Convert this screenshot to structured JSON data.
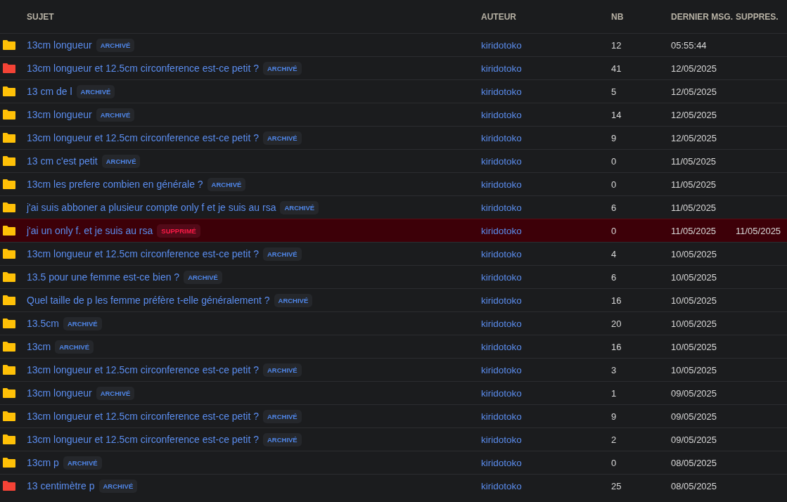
{
  "table": {
    "columns": [
      "SUJET",
      "AUTEUR",
      "NB",
      "DERNIER MSG.",
      "SUPPRES."
    ],
    "rows": [
      {
        "color": "#ffc107",
        "subject": "13cm longueur",
        "badge": {
          "label": "ARCHIVÉ",
          "kind": "archived"
        },
        "author": "kiridotoko",
        "count": "12",
        "last": "05:55:44"
      },
      {
        "color": "#f44336",
        "subject": "13cm longueur et 12.5cm circonference est-ce petit ?",
        "badge": {
          "label": "ARCHIVÉ",
          "kind": "archived"
        },
        "author": "kiridotoko",
        "count": "41",
        "last": "12/05/2025"
      },
      {
        "color": "#ffc107",
        "subject": "13 cm de l",
        "badge": {
          "label": "ARCHIVÉ",
          "kind": "archived"
        },
        "author": "kiridotoko",
        "count": "5",
        "last": "12/05/2025"
      },
      {
        "color": "#ffc107",
        "subject": "13cm longueur",
        "badge": {
          "label": "ARCHIVÉ",
          "kind": "archived"
        },
        "author": "kiridotoko",
        "count": "14",
        "last": "12/05/2025"
      },
      {
        "color": "#ffc107",
        "subject": "13cm longueur et 12.5cm circonference est-ce petit ?",
        "badge": {
          "label": "ARCHIVÉ",
          "kind": "archived"
        },
        "author": "kiridotoko",
        "count": "9",
        "last": "12/05/2025"
      },
      {
        "color": "#ffc107",
        "subject": "13 cm c'est petit",
        "badge": {
          "label": "ARCHIVÉ",
          "kind": "archived"
        },
        "author": "kiridotoko",
        "count": "0",
        "last": "11/05/2025"
      },
      {
        "color": "#ffc107",
        "subject": "13cm les prefere combien en générale ?",
        "badge": {
          "label": "ARCHIVÉ",
          "kind": "archived"
        },
        "author": "kiridotoko",
        "count": "0",
        "last": "11/05/2025"
      },
      {
        "color": "#ffc107",
        "subject": "j'ai suis abboner a plusieur compte only f et je suis au rsa",
        "badge": {
          "label": "ARCHIVÉ",
          "kind": "archived"
        },
        "author": "kiridotoko",
        "count": "6",
        "last": "11/05/2025"
      },
      {
        "color": "#ffc107",
        "subject": "j'ai un only f. et je suis au rsa",
        "badge": {
          "label": "SUPPRIMÉ",
          "kind": "deleted"
        },
        "author": "kiridotoko",
        "count": "0",
        "last": "11/05/2025",
        "deleted_on": "11/05/2025"
      },
      {
        "color": "#ffc107",
        "subject": "13cm longueur et 12.5cm circonference est-ce petit ?",
        "badge": {
          "label": "ARCHIVÉ",
          "kind": "archived"
        },
        "author": "kiridotoko",
        "count": "4",
        "last": "10/05/2025"
      },
      {
        "color": "#ffc107",
        "subject": "13.5 pour une femme est-ce bien ?",
        "badge": {
          "label": "ARCHIVÉ",
          "kind": "archived"
        },
        "author": "kiridotoko",
        "count": "6",
        "last": "10/05/2025"
      },
      {
        "color": "#ffc107",
        "subject": "Quel taille de p les femme préfère t-elle généralement ?",
        "badge": {
          "label": "ARCHIVÉ",
          "kind": "archived"
        },
        "author": "kiridotoko",
        "count": "16",
        "last": "10/05/2025"
      },
      {
        "color": "#ffc107",
        "subject": "13.5cm",
        "badge": {
          "label": "ARCHIVÉ",
          "kind": "archived"
        },
        "author": "kiridotoko",
        "count": "20",
        "last": "10/05/2025"
      },
      {
        "color": "#ffc107",
        "subject": "13cm",
        "badge": {
          "label": "ARCHIVÉ",
          "kind": "archived"
        },
        "author": "kiridotoko",
        "count": "16",
        "last": "10/05/2025"
      },
      {
        "color": "#ffc107",
        "subject": "13cm longueur et 12.5cm circonference est-ce petit ?",
        "badge": {
          "label": "ARCHIVÉ",
          "kind": "archived"
        },
        "author": "kiridotoko",
        "count": "3",
        "last": "10/05/2025"
      },
      {
        "color": "#ffc107",
        "subject": "13cm longueur",
        "badge": {
          "label": "ARCHIVÉ",
          "kind": "archived"
        },
        "author": "kiridotoko",
        "count": "1",
        "last": "09/05/2025"
      },
      {
        "color": "#ffc107",
        "subject": "13cm longueur et 12.5cm circonference est-ce petit ?",
        "badge": {
          "label": "ARCHIVÉ",
          "kind": "archived"
        },
        "author": "kiridotoko",
        "count": "9",
        "last": "09/05/2025"
      },
      {
        "color": "#ffc107",
        "subject": "13cm longueur et 12.5cm circonference est-ce petit ?",
        "badge": {
          "label": "ARCHIVÉ",
          "kind": "archived"
        },
        "author": "kiridotoko",
        "count": "2",
        "last": "09/05/2025"
      },
      {
        "color": "#ffc107",
        "subject": "13cm p",
        "badge": {
          "label": "ARCHIVÉ",
          "kind": "archived"
        },
        "author": "kiridotoko",
        "count": "0",
        "last": "08/05/2025"
      },
      {
        "color": "#f44336",
        "subject": "13 centimètre p",
        "badge": {
          "label": "ARCHIVÉ",
          "kind": "archived"
        },
        "author": "kiridotoko",
        "count": "25",
        "last": "08/05/2025"
      }
    ]
  }
}
